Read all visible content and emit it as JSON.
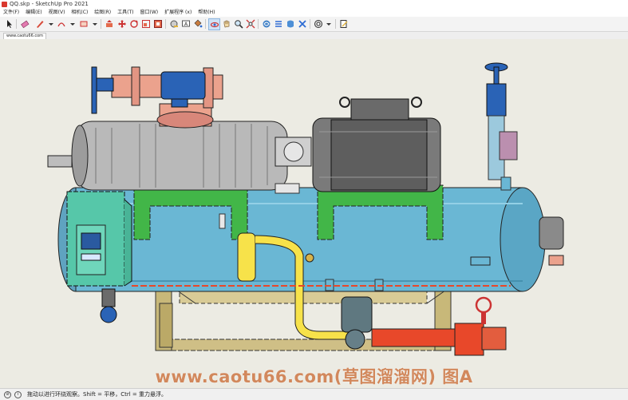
{
  "window": {
    "title": "QQ.skp - SketchUp Pro 2021"
  },
  "menu": [
    "文件(F)",
    "编辑(E)",
    "视图(V)",
    "相机(C)",
    "绘图(R)",
    "工具(T)",
    "窗口(W)",
    "扩展程序 (x)",
    "帮助(H)"
  ],
  "toolbar": {
    "buttons": [
      {
        "id": "select",
        "icon": "select-arrow-icon"
      },
      {
        "id": "eraser",
        "icon": "eraser-icon"
      },
      {
        "id": "pencil",
        "icon": "pencil-line-icon"
      },
      {
        "id": "arc",
        "icon": "arc-icon"
      },
      {
        "id": "shape",
        "icon": "rectangle-icon"
      },
      {
        "id": "pushpull",
        "icon": "push-pull-icon"
      },
      {
        "id": "move",
        "icon": "move-icon"
      },
      {
        "id": "rotate",
        "icon": "rotate-icon"
      },
      {
        "id": "scale",
        "icon": "scale-icon"
      },
      {
        "id": "offset",
        "icon": "offset-icon"
      },
      {
        "id": "tape",
        "icon": "tape-measure-icon"
      },
      {
        "id": "text",
        "icon": "text-icon"
      },
      {
        "id": "paint",
        "icon": "paint-bucket-icon"
      },
      {
        "id": "orbit",
        "icon": "orbit-icon"
      },
      {
        "id": "pan",
        "icon": "pan-hand-icon"
      },
      {
        "id": "zoom",
        "icon": "zoom-icon"
      },
      {
        "id": "zoom-extents",
        "icon": "zoom-extents-icon"
      },
      {
        "id": "warehouse",
        "icon": "3d-warehouse-icon"
      },
      {
        "id": "ext-warehouse",
        "icon": "extension-warehouse-icon"
      },
      {
        "id": "layout",
        "icon": "send-to-layout-icon"
      },
      {
        "id": "ext-manager",
        "icon": "extension-manager-icon"
      },
      {
        "id": "styles",
        "icon": "styles-icon"
      }
    ]
  },
  "tab": {
    "label": "www.caotu66.com"
  },
  "watermark": {
    "text": "www.caotu66.com(草图溜溜网) 图A"
  },
  "status": {
    "text": "拖动以进行环绕观察。Shift = 平移，Ctrl = 重力悬浮。"
  },
  "colors": {
    "viewport_bg": "#ecebe3",
    "vessel": "#6ab7d4",
    "motor": "#7a7a7a",
    "compressor": "#b9b9b9",
    "frame": "#cfbf86",
    "support": "#42b648",
    "control_panel": "#56c7a9",
    "pipe_yellow": "#f7e24a",
    "valve_blue": "#2a63b6",
    "flange_pink": "#eba28d",
    "filter_red": "#e8482a"
  }
}
